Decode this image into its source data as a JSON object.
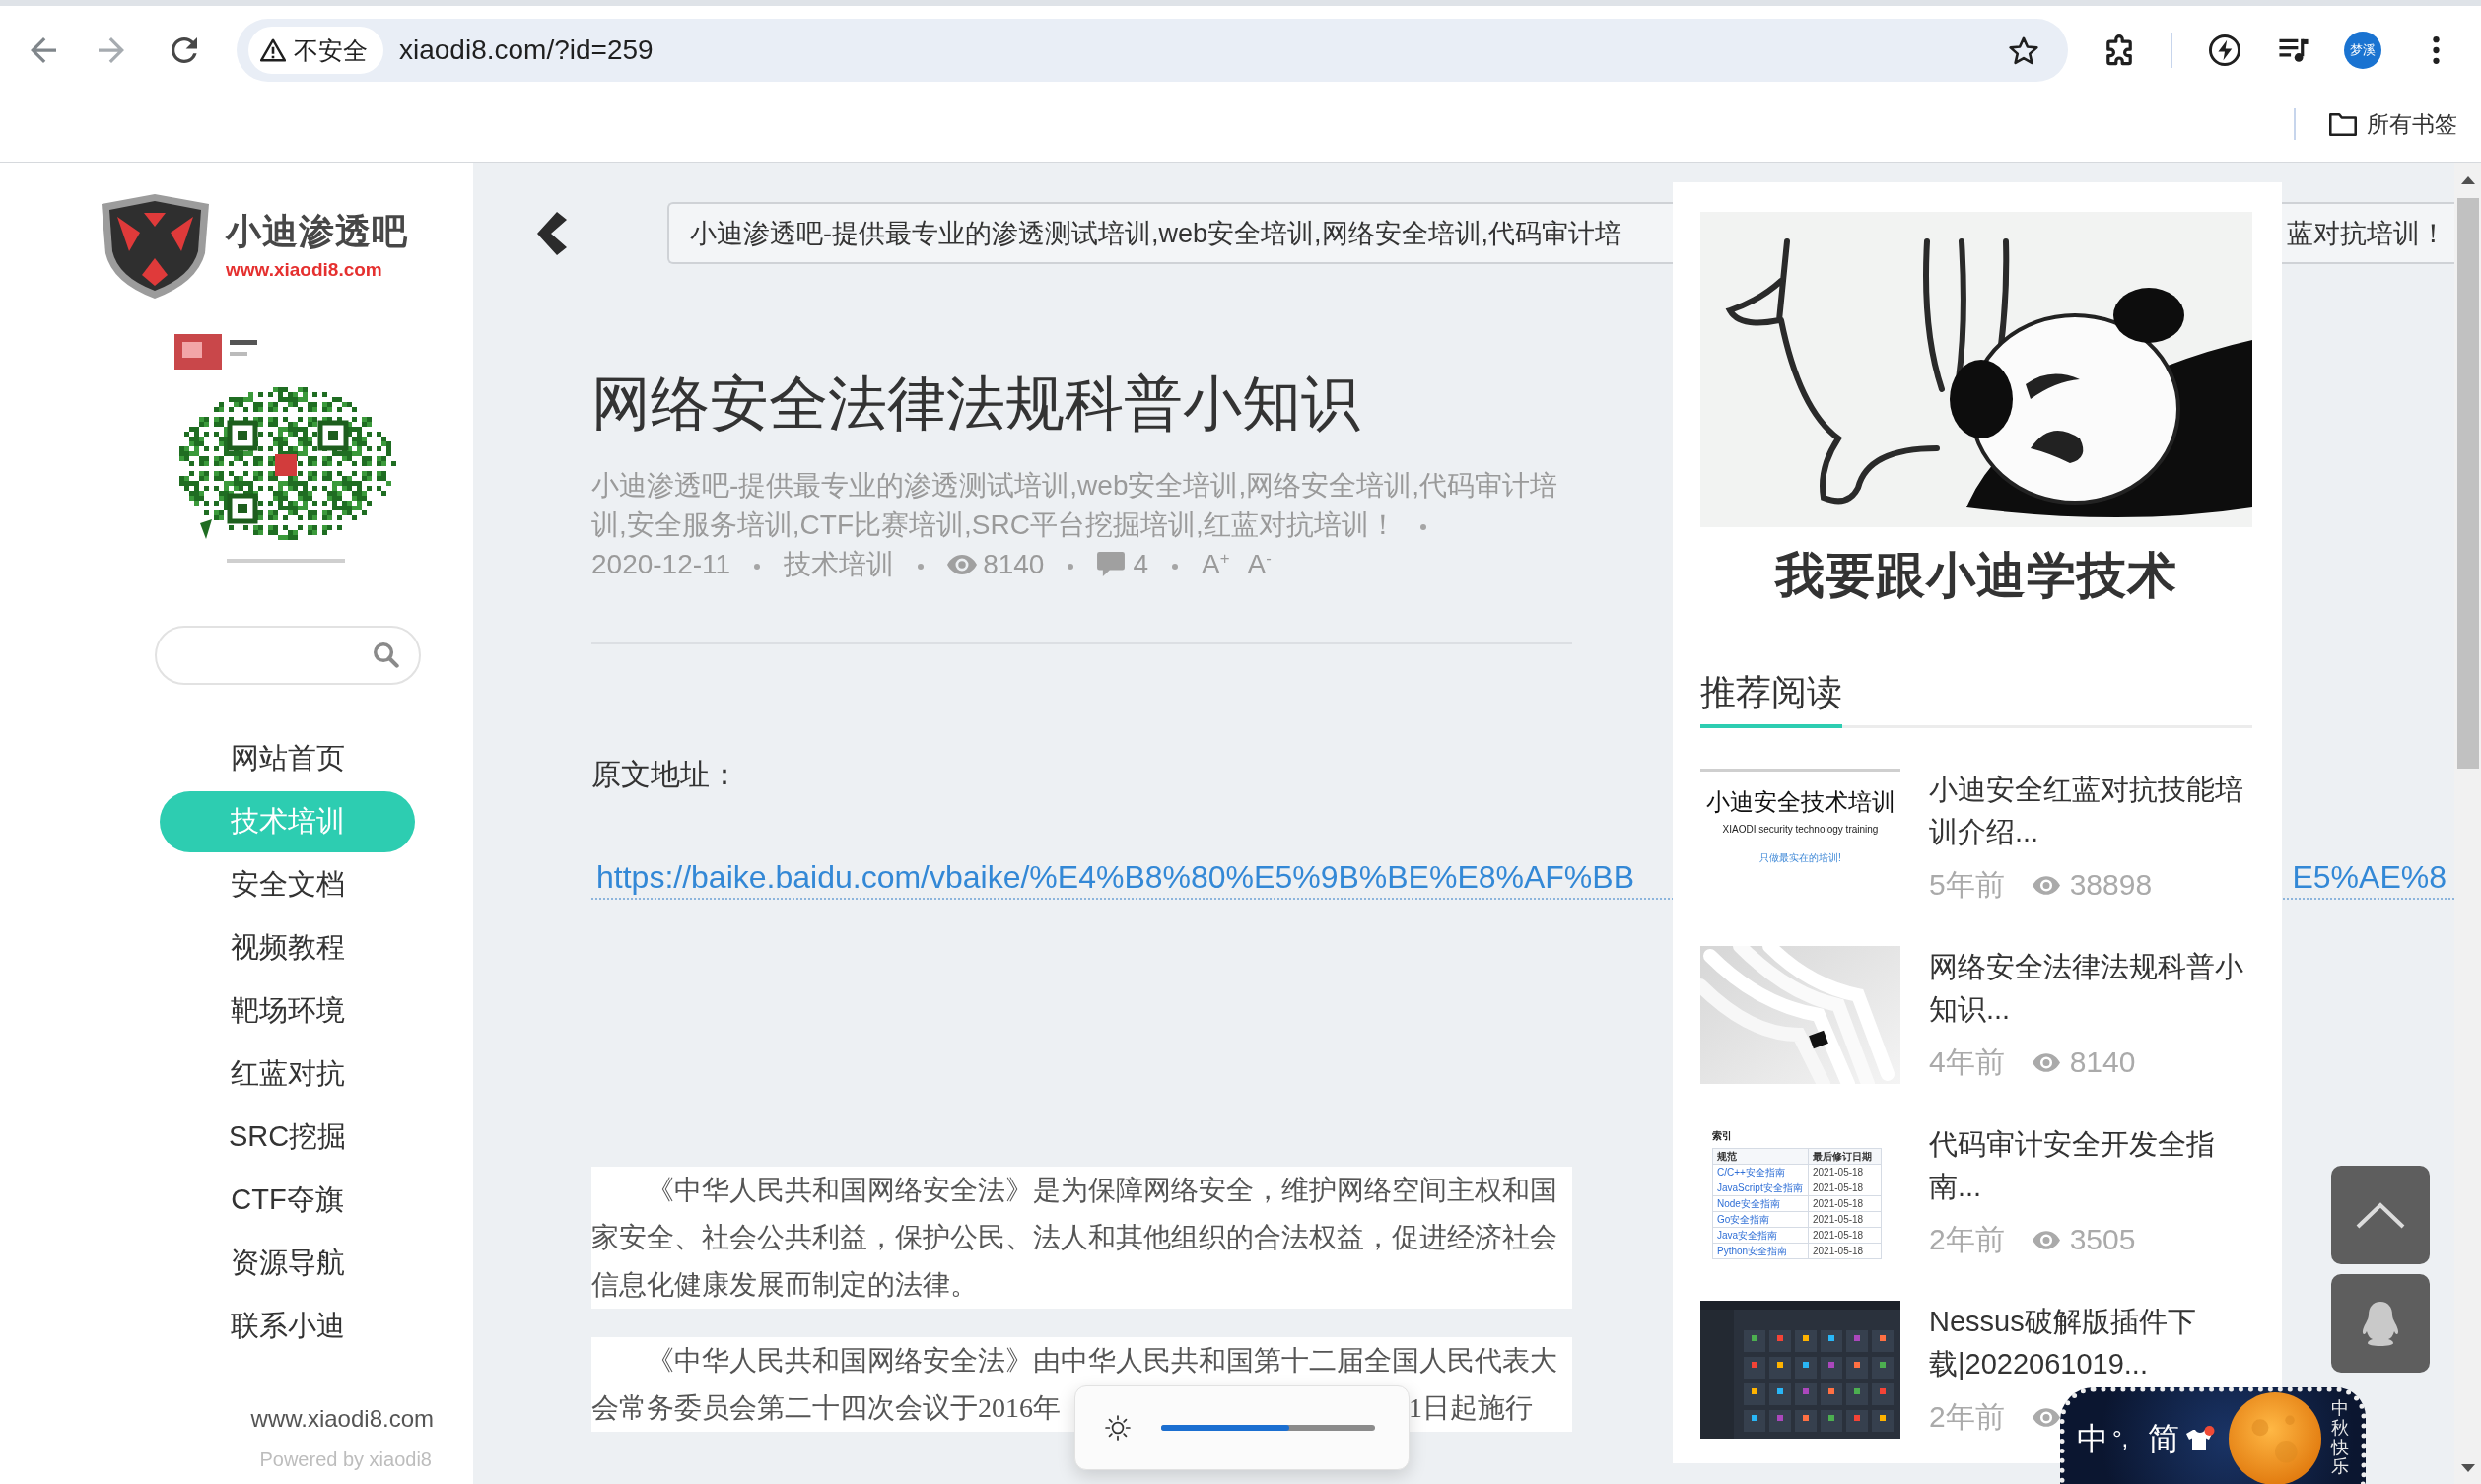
{
  "browser": {
    "security_label": "不安全",
    "url": "xiaodi8.com/?id=259",
    "profile_name": "梦溪",
    "bookmarks_folder": "所有书签"
  },
  "sidebar": {
    "logo": {
      "name": "小迪渗透吧",
      "url": "www.xiaodi8.com"
    },
    "nav": [
      {
        "label": "网站首页",
        "selected": false
      },
      {
        "label": "技术培训",
        "selected": true
      },
      {
        "label": "安全文档",
        "selected": false
      },
      {
        "label": "视频教程",
        "selected": false
      },
      {
        "label": "靶场环境",
        "selected": false
      },
      {
        "label": "红蓝对抗",
        "selected": false
      },
      {
        "label": "SRC挖掘",
        "selected": false
      },
      {
        "label": "CTF夺旗",
        "selected": false
      },
      {
        "label": "资源导航",
        "selected": false
      },
      {
        "label": "联系小迪",
        "selected": false
      }
    ],
    "footer": {
      "site": "www.xiaodi8.com",
      "powered_by": "Powered by xiaodi8"
    }
  },
  "notice_bar": {
    "text_start": "小迪渗透吧-提供最专业的渗透测试培训,web安全培训,网络安全培训,代码审计培",
    "text_end": "蓝对抗培训！"
  },
  "article": {
    "title": "网络安全法律法规科普小知识",
    "description": "小迪渗透吧-提供最专业的渗透测试培训,web安全培训,网络安全培训,代码审计培训,安全服务培训,CTF比赛培训,SRC平台挖掘培训,红蓝对抗培训！",
    "date": "2020-12-11",
    "category": "技术培训",
    "views": "8140",
    "comments": "4",
    "font_buttons": [
      "A$^{+}$",
      "A$^{-}$"
    ],
    "source_label": "原文地址：",
    "source_link_start": "https://baike.baidu.com/vbaike/%E4%B8%80%E5%9B%BE%E8%AF%BB",
    "source_link_end": "E5%AE%8",
    "paragraphs": [
      {
        "text": "《中华人民共和国网络安全法》是为保障网络安全，维护网络空间主权和国家安全、社会公共利益，保护公民、法人和其他组织的合法权益，促进经济社会信息化健康发展而制定的法律。"
      }
    ],
    "covered_paragraph": {
      "first_line": "《中华人民共和国网络安全法》由中华人民共和国第十二届全国人民代表大",
      "second_line_start": "会常务委员会第二十四次会议于2016年",
      "second_line_end": "1日起施行"
    }
  },
  "recommend": {
    "image_caption": "我要跟小迪学技术",
    "heading": "推荐阅读",
    "items": [
      {
        "thumbnail": {
          "kind": "banner",
          "title": "小迪安全技术培训",
          "subtitle": "XIAODI security technology training",
          "slogan": "只做最实在的培训!"
        },
        "title": "小迪安全红蓝对抗技能培训介绍...",
        "age": "5年前",
        "views": "38898"
      },
      {
        "thumbnail": {
          "kind": "photo"
        },
        "title": "网络安全法律法规科普小知识...",
        "age": "4年前",
        "views": "8140"
      },
      {
        "thumbnail": {
          "kind": "table",
          "heading": "索引",
          "columns": [
            "规范",
            "最后修订日期"
          ],
          "rows": [
            [
              "C/C++安全指南",
              "2021-05-18"
            ],
            [
              "JavaScript安全指南",
              "2021-05-18"
            ],
            [
              "Node安全指南",
              "2021-05-18"
            ],
            [
              "Go安全指南",
              "2021-05-18"
            ],
            [
              "Java安全指南",
              "2021-05-18"
            ],
            [
              "Python安全指南",
              "2021-05-18"
            ]
          ]
        },
        "title": "代码审计安全开发全指南...",
        "age": "2年前",
        "views": "3505"
      },
      {
        "thumbnail": {
          "kind": "screenshot"
        },
        "title": "Nessus破解版插件下载|2022061019...",
        "age": "2年前"
      }
    ]
  },
  "brightness_popup": {
    "level": 0.6
  },
  "input_method": {
    "mode": "中",
    "punctuation": "°,",
    "script": "简",
    "skin_text": "中秋快乐"
  }
}
